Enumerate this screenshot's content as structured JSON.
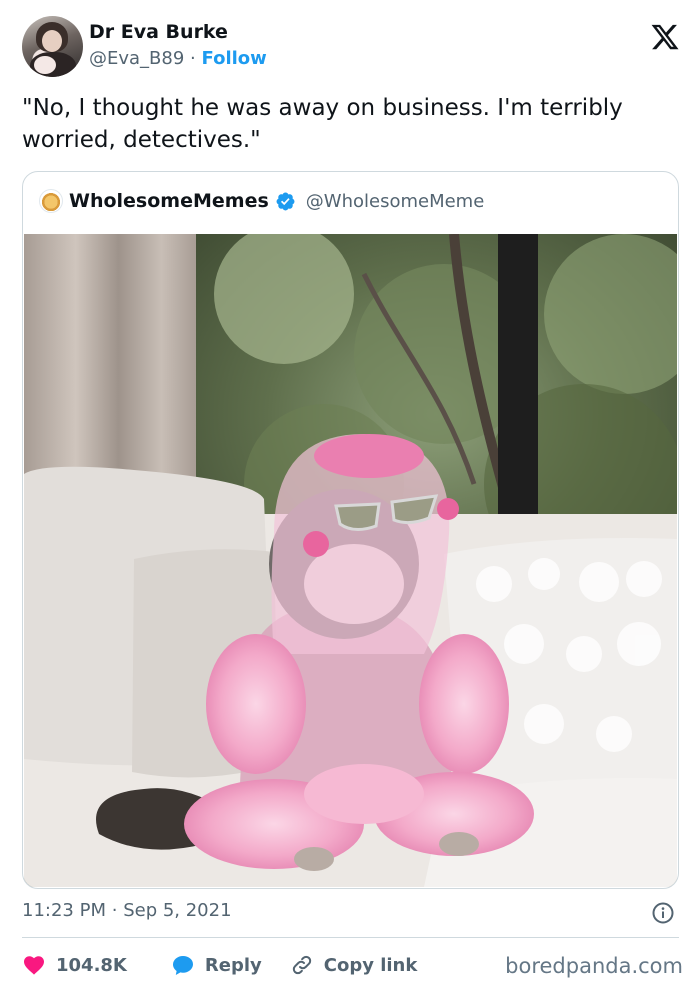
{
  "author": {
    "name": "Dr Eva Burke",
    "handle": "@Eva_B89",
    "separator": "·",
    "follow_label": "Follow"
  },
  "tweet": {
    "text": "\"No, I thought he was away on business. I'm terribly worried, detectives.\""
  },
  "quoted": {
    "name": "WholesomeMemes",
    "handle": "@WholesomeMeme",
    "image_alt": "Gray kitten wearing pink hair curlers, a sheer pink headscarf, cat-eye sunglasses and a pink feather-trimmed robe, sitting by a window"
  },
  "meta": {
    "time": "11:23 PM",
    "separator": "·",
    "date": "Sep 5, 2021"
  },
  "actions": {
    "likes": "104.8K",
    "reply_label": "Reply",
    "copy_label": "Copy link"
  },
  "watermark": "boredpanda.com",
  "colors": {
    "link": "#1d9bf0",
    "like": "#f91880",
    "muted": "#536471",
    "border": "#cfd9de"
  },
  "icons": [
    "x-logo-icon",
    "verified-icon",
    "info-icon",
    "heart-icon",
    "reply-bubble-icon",
    "link-icon"
  ]
}
